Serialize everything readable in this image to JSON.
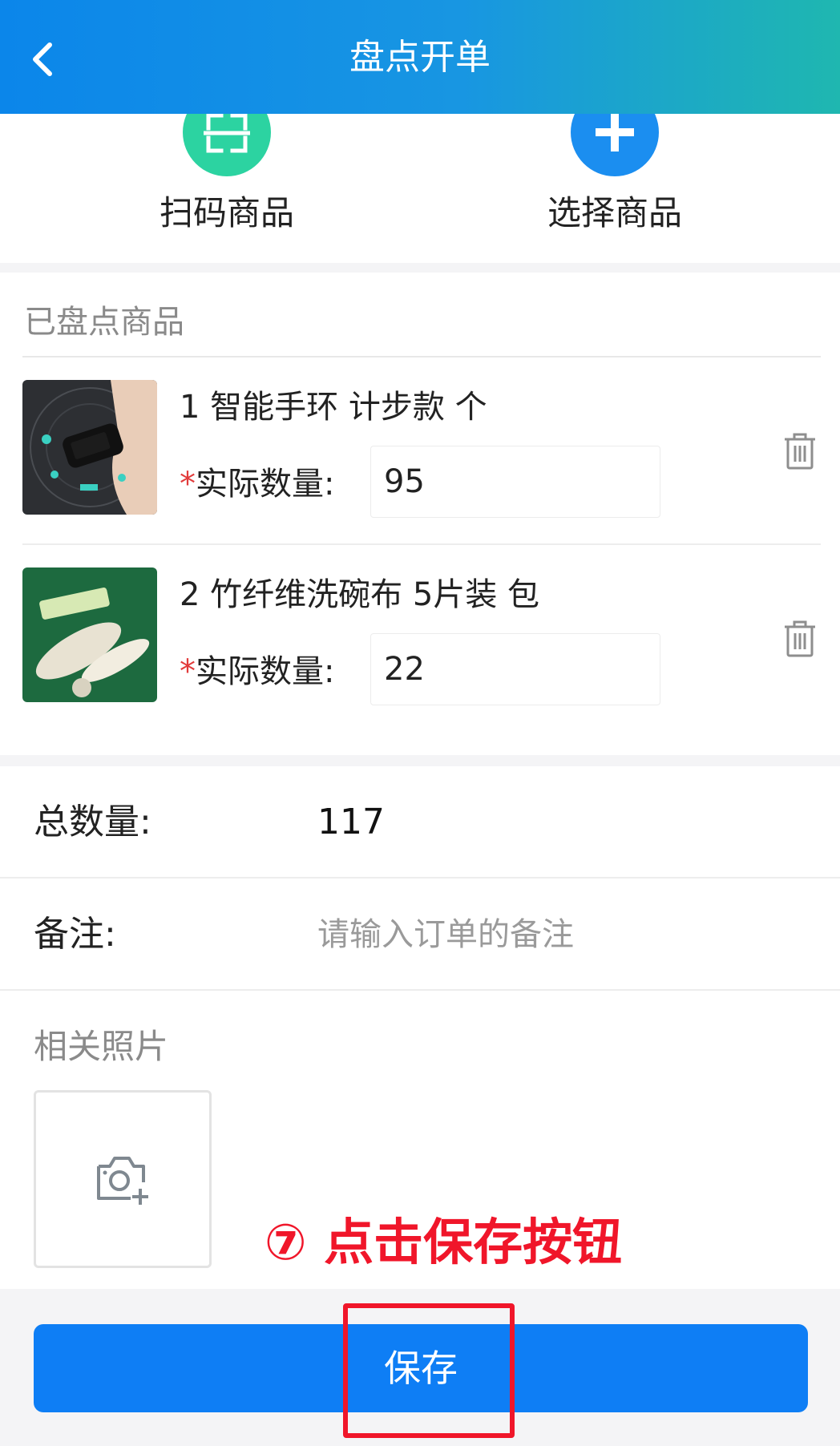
{
  "header": {
    "title": "盘点开单",
    "back_icon": "chevron-left-icon",
    "gradient_colors": [
      "#0b86ea",
      "#1fb7b0"
    ]
  },
  "actions": {
    "scan": {
      "label": "扫码商品",
      "icon": "scan-icon",
      "color": "#2cd3a1"
    },
    "select": {
      "label": "选择商品",
      "icon": "plus-icon",
      "color": "#1b8ef0"
    }
  },
  "counted_section": {
    "title": "已盘点商品",
    "items": [
      {
        "name": "1 智能手环 计步款 个",
        "qty_label": "实际数量:",
        "required_mark": "*",
        "qty_value": "95",
        "thumbnail": "smart-band-thumbnail",
        "delete_icon": "trash-icon"
      },
      {
        "name": "2 竹纤维洗碗布 5片装 包",
        "qty_label": "实际数量:",
        "required_mark": "*",
        "qty_value": "22",
        "thumbnail": "dish-cloth-thumbnail",
        "delete_icon": "trash-icon"
      }
    ]
  },
  "form": {
    "total_label": "总数量:",
    "total_value": "117",
    "remark_label": "备注:",
    "remark_placeholder": "请输入订单的备注",
    "photos_title": "相关照片",
    "photo_icon": "camera-add-icon"
  },
  "annotation": {
    "text": "⑦ 点击保存按钮",
    "color": "#f0162a"
  },
  "save_button": {
    "label": "保存",
    "color": "#0e7ef5"
  }
}
